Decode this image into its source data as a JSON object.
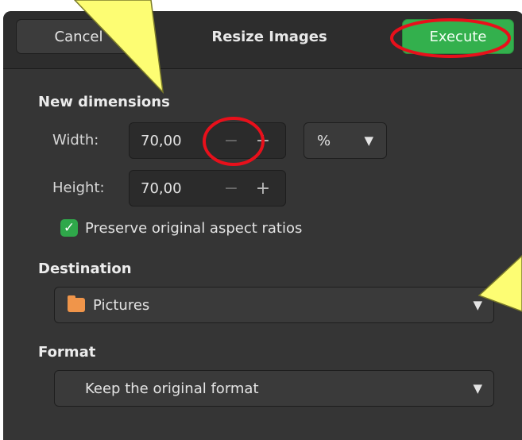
{
  "dialog": {
    "title": "Resize Images",
    "cancel_label": "Cancel",
    "execute_label": "Execute"
  },
  "dimensions": {
    "heading": "New dimensions",
    "width_label": "Width:",
    "width_value": "70,00",
    "height_label": "Height:",
    "height_value": "70,00",
    "minus_glyph": "−",
    "plus_glyph": "+",
    "unit": "%",
    "preserve_label": "Preserve original aspect ratios",
    "preserve_checked": true
  },
  "destination": {
    "heading": "Destination",
    "value": "Pictures",
    "icon": "folder-icon"
  },
  "format": {
    "heading": "Format",
    "value": "Keep the original format"
  },
  "colors": {
    "accent": "#33b04d",
    "annotation_fill": "#fdfd73",
    "annotation_circle": "#e8101b"
  }
}
